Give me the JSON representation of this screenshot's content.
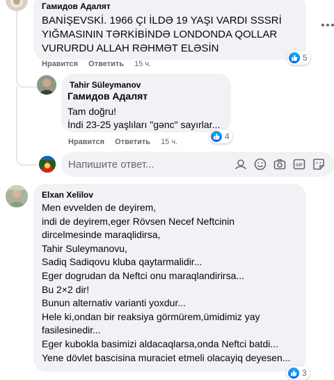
{
  "comments": [
    {
      "author": "Гамидов Адалят",
      "text": "BANİŞEVSKİ. 1966 ÇI İLDƏ 19 YAŞI VARDI SSSRİ\nYIĞMASININ TƏRKİBİNDƏ LONDONDA QOLLAR\nVURURDU ALLAH RƏHMƏT ELƏSİN",
      "like_label": "Нравится",
      "reply_label": "Ответить",
      "time": "15 ч.",
      "reaction_count": "5",
      "replies": [
        {
          "author": "Tahir Süleymanov",
          "mention": "Гамидов Адалят",
          "text": "Tam doğru!\nİndi 23-25 yaşlıları \"gənc\" sayırlar...",
          "like_label": "Нравится",
          "reply_label": "Ответить",
          "time": "15 ч.",
          "reaction_count": "4"
        }
      ]
    },
    {
      "author": "Elxan Xelilov",
      "text": "Men evvelden de deyirem,\nindi de deyirem,eger Rövsen Necef Neftcinin\ndircelmesinde maraqlidirsa,\nTahir Suleymanovu,\nSadiq Sadiqovu kluba qaytarmalidir...\nEger dogrudan da Neftci onu maraqlandirirsa...\nBu 2×2 dir!\nBunun alternativ varianti yoxdur...\nHele ki,ondan bir reaksiya görmürem,ümidimiz yay\nfasilesinedir...\nEger kubokla basimizi aldacaqlarsa,onda Neftci batdi...\nYene dövlet bascisina muraciet etmeli olacayiq deyesen...",
      "reaction_count": "3"
    }
  ],
  "reply_input": {
    "placeholder": "Напишите ответ..."
  },
  "colors": {
    "like_blue": "#1877f2",
    "bubble_bg": "#f0f2f5",
    "secondary_text": "#65676b"
  }
}
